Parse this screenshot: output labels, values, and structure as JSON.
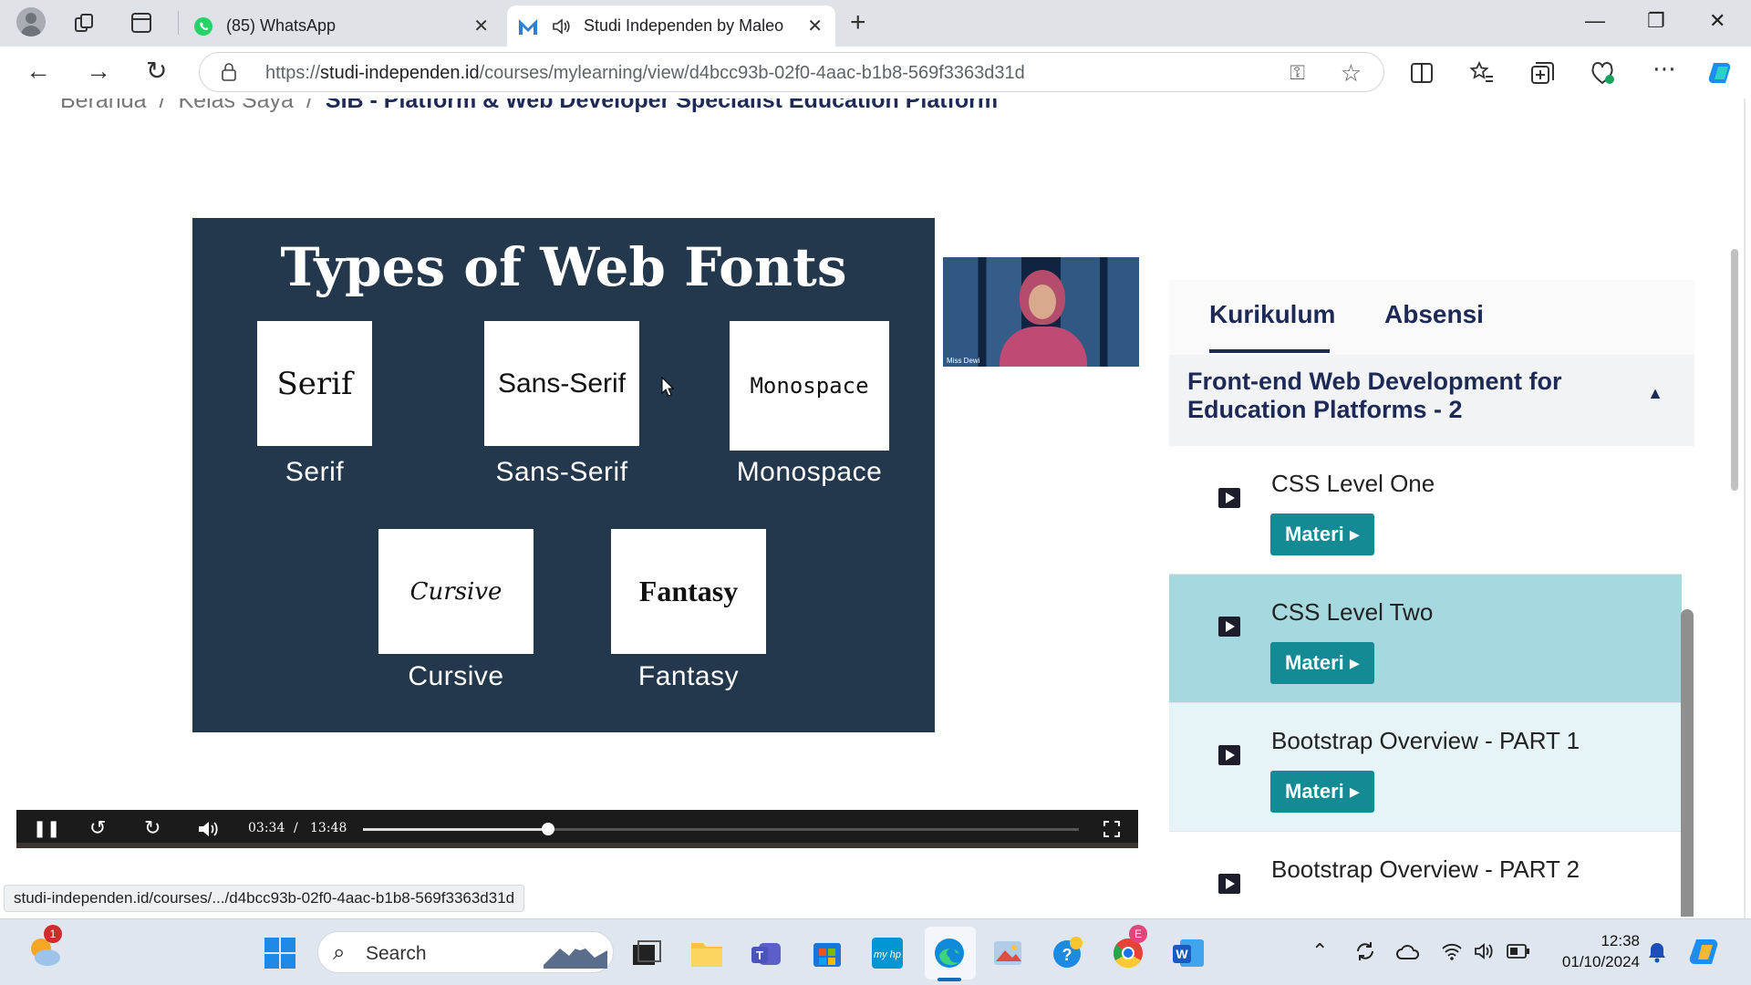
{
  "browser": {
    "tabs": [
      {
        "title": "(85) WhatsApp",
        "close": "✕"
      },
      {
        "title": "Studi Independen by Maleo",
        "close": "✕"
      }
    ],
    "new_tab": "+",
    "window": {
      "minimize": "—",
      "restore": "❐",
      "close": "✕"
    },
    "url": {
      "scheme": "https://",
      "host": "studi-independen.id",
      "path": "/courses/mylearning/view/d4bcc93b-02f0-4aac-b1b8-569f3363d31d"
    },
    "status_url": "studi-independen.id/courses/.../d4bcc93b-02f0-4aac-b1b8-569f3363d31d"
  },
  "breadcrumb": {
    "home": "Beranda",
    "my_classes": "Kelas Saya",
    "current": "SIB - Platform & Web Developer Specialist Education Platform",
    "separator": "/"
  },
  "slide": {
    "title": "Types of Web Fonts",
    "fonts": [
      {
        "sample": "Serif",
        "caption": "Serif"
      },
      {
        "sample": "Sans-Serif",
        "caption": "Sans-Serif"
      },
      {
        "sample": "Monospace",
        "caption": "Monospace"
      },
      {
        "sample": "Cursive",
        "caption": "Cursive"
      },
      {
        "sample": "Fantasy",
        "caption": "Fantasy"
      }
    ]
  },
  "webcam": {
    "name_tag": "Miss Dewi"
  },
  "player": {
    "current_time": "03:34",
    "separator": "/",
    "duration": "13:48",
    "progress_fraction": 0.258
  },
  "sidebar": {
    "tabs": [
      "Kurikulum",
      "Absensi"
    ],
    "section_title": "Front-end Web Development for Education Platforms - 2",
    "caret": "▲",
    "lessons": [
      {
        "name": "CSS Level One",
        "button": "Materi ▸",
        "active": false
      },
      {
        "name": "CSS Level Two",
        "button": "Materi ▸",
        "active": true
      },
      {
        "name": "Bootstrap Overview - PART 1",
        "button": "Materi ▸",
        "active": false
      },
      {
        "name": "Bootstrap Overview - PART 2",
        "button": "",
        "active": false
      }
    ]
  },
  "taskbar": {
    "search_label": "Search",
    "weather_badge": "1",
    "chrome_badge": "E",
    "clock_time": "12:38",
    "clock_date": "01/10/2024"
  },
  "colors": {
    "accent_button": "#138a94",
    "active_lesson_bg": "#a6d9df",
    "hover_lesson_bg": "#e6f4f7",
    "slide_bg": "#23384d",
    "heading": "#1d2a57"
  }
}
